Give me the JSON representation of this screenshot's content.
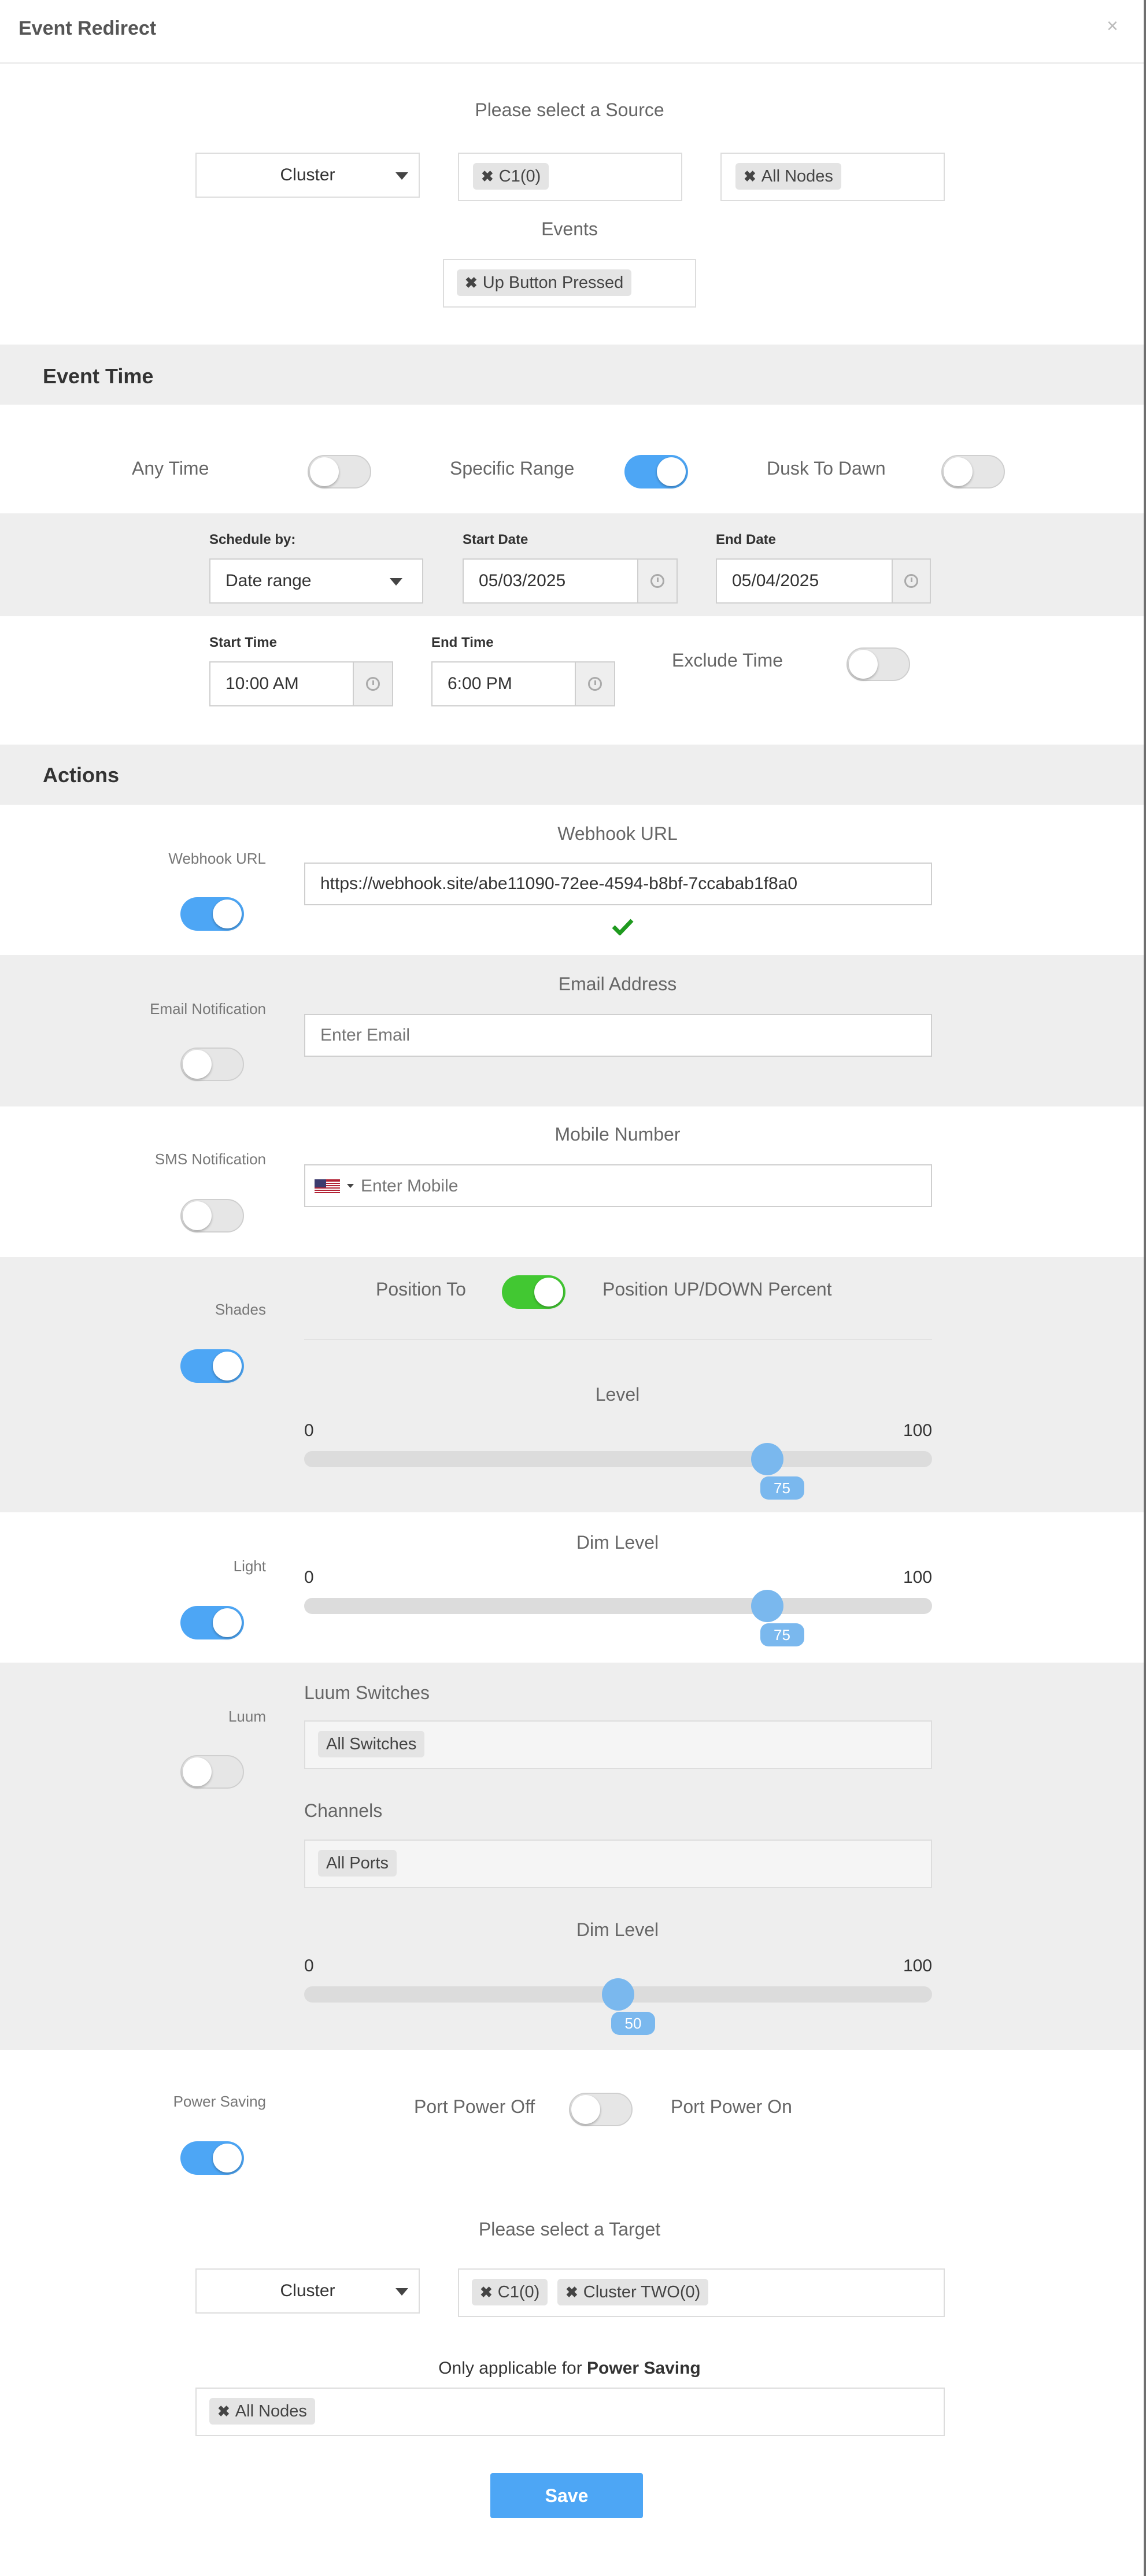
{
  "dialog": {
    "title": "Event Redirect",
    "close_symbol": "×"
  },
  "source": {
    "heading": "Please select a Source",
    "type_select": "Cluster",
    "cluster_tags": [
      "C1(0)"
    ],
    "node_tags": [
      "All Nodes"
    ],
    "events_label": "Events",
    "event_tags": [
      "Up Button Pressed"
    ]
  },
  "event_time": {
    "heading": "Event Time",
    "any_time_label": "Any Time",
    "specific_range_label": "Specific Range",
    "dusk_to_dawn_label": "Dusk To Dawn",
    "schedule_by_label": "Schedule by:",
    "schedule_by_value": "Date range",
    "start_date_label": "Start Date",
    "start_date_value": "05/03/2025",
    "end_date_label": "End Date",
    "end_date_value": "05/04/2025",
    "start_time_label": "Start Time",
    "start_time_value": "10:00 AM",
    "end_time_label": "End Time",
    "end_time_value": "6:00 PM",
    "exclude_time_label": "Exclude Time"
  },
  "actions": {
    "heading": "Actions",
    "webhook": {
      "side_label": "Webhook URL",
      "field_label": "Webhook URL",
      "value": "https://webhook.site/abe11090-72ee-4594-b8bf-7ccabab1f8a0",
      "valid_icon": "check-icon"
    },
    "email": {
      "side_label": "Email Notification",
      "field_label": "Email Address",
      "placeholder": "Enter Email"
    },
    "sms": {
      "side_label": "SMS Notification",
      "field_label": "Mobile Number",
      "placeholder": "Enter Mobile",
      "flag_icon": "us-flag-icon"
    },
    "shades": {
      "side_label": "Shades",
      "position_to_label": "Position To",
      "position_percent_label": "Position UP/DOWN Percent",
      "level_label": "Level",
      "min": "0",
      "max": "100",
      "value": "75"
    },
    "light": {
      "side_label": "Light",
      "dim_label": "Dim Level",
      "min": "0",
      "max": "100",
      "value": "75"
    },
    "luum": {
      "side_label": "Luum",
      "switches_label": "Luum Switches",
      "switch_tags": [
        "All Switches"
      ],
      "channels_label": "Channels",
      "channel_tags": [
        "All Ports"
      ],
      "dim_label": "Dim Level",
      "min": "0",
      "max": "100",
      "value": "50"
    },
    "power_saving": {
      "side_label": "Power Saving",
      "off_label": "Port Power Off",
      "on_label": "Port Power On"
    }
  },
  "target": {
    "heading": "Please select a Target",
    "type_select": "Cluster",
    "cluster_tags": [
      "C1(0)",
      "Cluster TWO(0)"
    ],
    "note_prefix": "Only applicable for ",
    "note_bold": "Power Saving",
    "node_tags": [
      "All Nodes"
    ]
  },
  "save_label": "Save",
  "colors": {
    "accent": "#4da6f5",
    "green_toggle": "#42c832",
    "section_gray": "#eeeeee",
    "slider_thumb": "#7ab8ee",
    "check": "#1f9a1f"
  }
}
